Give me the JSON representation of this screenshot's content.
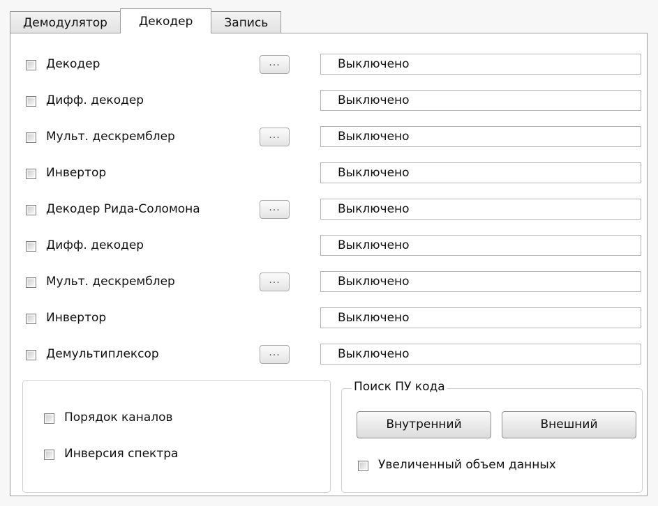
{
  "tabs": [
    {
      "label": "Демодулятор",
      "active": false
    },
    {
      "label": "Декодер",
      "active": true
    },
    {
      "label": "Запись",
      "active": false
    }
  ],
  "dots_label": "...",
  "rows": [
    {
      "label": "Декодер",
      "has_dots": true,
      "status": "Выключено",
      "checked": false
    },
    {
      "label": "Дифф. декодер",
      "has_dots": false,
      "status": "Выключено",
      "checked": false
    },
    {
      "label": "Мульт. дескремблер",
      "has_dots": true,
      "status": "Выключено",
      "checked": false
    },
    {
      "label": "Инвертор",
      "has_dots": false,
      "status": "Выключено",
      "checked": false
    },
    {
      "label": "Декодер Рида-Соломона",
      "has_dots": true,
      "status": "Выключено",
      "checked": false
    },
    {
      "label": "Дифф. декодер",
      "has_dots": false,
      "status": "Выключено",
      "checked": false
    },
    {
      "label": "Мульт. дескремблер",
      "has_dots": true,
      "status": "Выключено",
      "checked": false
    },
    {
      "label": "Инвертор",
      "has_dots": false,
      "status": "Выключено",
      "checked": false
    },
    {
      "label": "Демультиплексор",
      "has_dots": true,
      "status": "Выключено",
      "checked": false
    }
  ],
  "options": {
    "channel_order": {
      "label": "Порядок каналов",
      "checked": false
    },
    "spectrum_inversion": {
      "label": "Инверсия спектра",
      "checked": false
    }
  },
  "code_search": {
    "title": "Поиск ПУ кода",
    "internal_button": "Внутренний",
    "external_button": "Внешний",
    "large_data": {
      "label": "Увеличенный объем данных",
      "checked": false
    }
  }
}
